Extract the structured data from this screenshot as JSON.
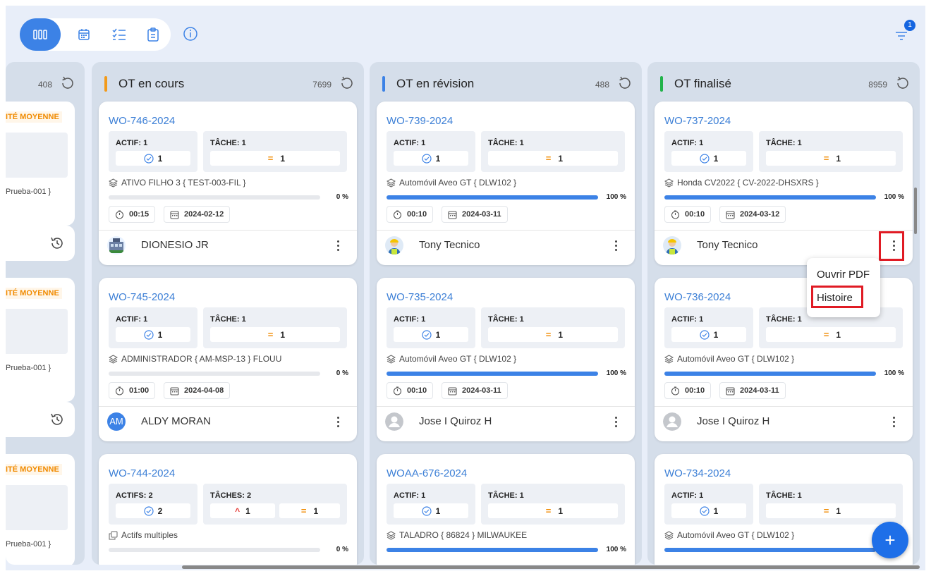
{
  "toolbar": {
    "views": [
      "board-view",
      "calendar-view",
      "checklist-view",
      "clipboard-view"
    ],
    "filter_badge": "1"
  },
  "partial_column": {
    "count": "408",
    "cards": [
      {
        "priority": "ITÉ MOYENNE",
        "asset_fragment": "Prueba-001 }"
      },
      {
        "priority": "ITÉ MOYENNE",
        "asset_fragment": "Prueba-001 }"
      },
      {
        "priority": "ITÉ MOYENNE",
        "asset_fragment": "Prueba-001 }"
      }
    ]
  },
  "columns": [
    {
      "title": "OT en cours",
      "count": "7699",
      "accent": "#f29a1a",
      "cards": [
        {
          "wo": "WO-746-2024",
          "actif_label": "ACTIF: 1",
          "actif_value": "1",
          "tache_label": "TÂCHE: 1",
          "tache_value": "1",
          "asset": "ATIVO FILHO 3 { TEST-003-FIL }",
          "progress": "0 %",
          "progress_value": 0,
          "duration": "00:15",
          "date": "2024-02-12",
          "user": "DIONESIO JR",
          "avatar": "building"
        },
        {
          "wo": "WO-745-2024",
          "actif_label": "ACTIF: 1",
          "actif_value": "1",
          "tache_label": "TÂCHE: 1",
          "tache_value": "1",
          "asset": "ADMINISTRADOR { AM-MSP-13 } FLOUU",
          "progress": "0 %",
          "progress_value": 0,
          "duration": "01:00",
          "date": "2024-04-08",
          "user": "ALDY MORAN",
          "avatar": "initials",
          "initials": "AM"
        },
        {
          "wo": "WO-744-2024",
          "actif_label": "ACTIFS: 2",
          "actif_value": "2",
          "tache_label": "TÂCHES: 2",
          "tache_up": "1",
          "tache_value": "1",
          "asset": "Actifs multiples",
          "progress": "0 %",
          "progress_value": 0
        }
      ]
    },
    {
      "title": "OT en révision",
      "count": "488",
      "accent": "#3c82e6",
      "cards": [
        {
          "wo": "WO-739-2024",
          "actif_label": "ACTIF: 1",
          "actif_value": "1",
          "tache_label": "TÂCHE: 1",
          "tache_value": "1",
          "asset": "Automóvil Aveo GT { DLW102 }",
          "progress": "100 %",
          "progress_value": 1,
          "duration": "00:10",
          "date": "2024-03-11",
          "user": "Tony Tecnico",
          "avatar": "worker"
        },
        {
          "wo": "WO-735-2024",
          "actif_label": "ACTIF: 1",
          "actif_value": "1",
          "tache_label": "TÂCHE: 1",
          "tache_value": "1",
          "asset": "Automóvil Aveo GT { DLW102 }",
          "progress": "100 %",
          "progress_value": 1,
          "duration": "00:10",
          "date": "2024-03-11",
          "user": "Jose I Quiroz H",
          "avatar": "person"
        },
        {
          "wo": "WOAA-676-2024",
          "actif_label": "ACTIF: 1",
          "actif_value": "1",
          "tache_label": "TÂCHE: 1",
          "tache_value": "1",
          "asset": "TALADRO { 86824 } MILWAUKEE",
          "progress": "100 %",
          "progress_value": 1
        }
      ]
    },
    {
      "title": "OT finalisé",
      "count": "8959",
      "accent": "#22b34a",
      "cards": [
        {
          "wo": "WO-737-2024",
          "actif_label": "ACTIF: 1",
          "actif_value": "1",
          "tache_label": "TÂCHE: 1",
          "tache_value": "1",
          "asset": "Honda CV2022 { CV-2022-DHSXRS }",
          "progress": "100 %",
          "progress_value": 1,
          "duration": "00:10",
          "date": "2024-03-12",
          "user": "Tony Tecnico",
          "avatar": "worker"
        },
        {
          "wo": "WO-736-2024",
          "actif_label": "ACTIF: 1",
          "actif_value": "1",
          "tache_label": "TÂCHE: 1",
          "tache_value": "1",
          "asset": "Automóvil Aveo GT { DLW102 }",
          "progress": "100 %",
          "progress_value": 1,
          "duration": "00:10",
          "date": "2024-03-11",
          "user": "Jose I Quiroz H",
          "avatar": "person"
        },
        {
          "wo": "WO-734-2024",
          "actif_label": "ACTIF: 1",
          "actif_value": "1",
          "tache_label": "TÂCHE: 1",
          "tache_value": "1",
          "asset": "Automóvil Aveo GT { DLW102 }",
          "progress": "",
          "progress_value": 1
        }
      ]
    }
  ],
  "context_menu": {
    "items": [
      "Ouvrir PDF",
      "Histoire"
    ]
  },
  "fab_label": "+",
  "colors": {
    "primary": "#3c82e6",
    "highlight": "#e01b24",
    "priority": "#f08a00"
  }
}
